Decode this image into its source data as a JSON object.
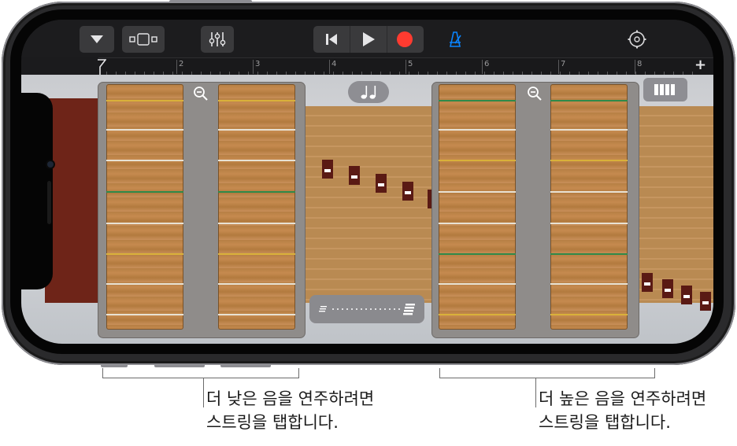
{
  "controls": {
    "browser_icon": "triangle-down-icon",
    "tracks_icon": "tracks-view-icon",
    "mixer_icon": "mixer-sliders-icon",
    "rewind_icon": "go-to-beginning-icon",
    "play_icon": "play-icon",
    "record_icon": "record-icon",
    "metronome_icon": "metronome-icon",
    "settings_icon": "settings-gear-icon",
    "record_color": "#ff3b30",
    "metronome_color": "#0a84ff"
  },
  "ruler": {
    "bars": [
      "2",
      "3",
      "4",
      "5",
      "6",
      "7",
      "8"
    ],
    "add_label": "+"
  },
  "instrument": {
    "chord_toggle_icon": "notes-icon",
    "glissando_icon": "glissando-slider-icon",
    "keyboard_toggle_icon": "keyboard-icon"
  },
  "captions": {
    "low": "더 낮은 음을 연주하려면\n스트링을 탭합니다.",
    "low_line1": "더 낮은 음을 연주하려면",
    "low_line2": "스트링을 탭합니다.",
    "high_line1": "더 높은 음을 연주하려면",
    "high_line2": "스트링을 탭합니다."
  }
}
